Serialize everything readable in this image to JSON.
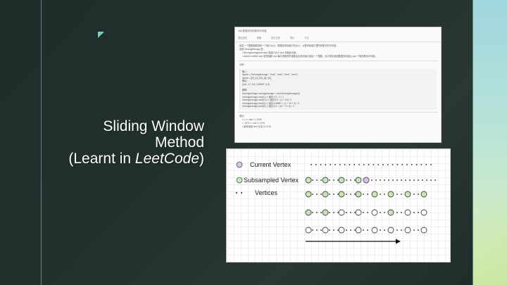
{
  "slide": {
    "title_line1": "Sliding Window",
    "title_line2": "Method",
    "title_line3_prefix": "(Learnt in ",
    "title_line3_italic": "LeetCode",
    "title_line3_suffix": ")",
    "colors": {
      "accent": "#7ecbc0",
      "background": "#22302c",
      "title": "#ffffff"
    }
  },
  "doc": {
    "header": "346.数据流中的移动平均值",
    "tabs": [
      "题目描述",
      "题解",
      "提交记录",
      "笔记",
      "讨论"
    ],
    "lines": [
      "给定一个整数数据流和一个窗口大小，根据该滑动窗口的大小，计算滑动窗口里所有数字的平均值。",
      "实现 MovingAverage 类：",
      "• MovingAverage(int size) 用窗口大小 size 初始化对象。",
      "• double next(int val) 成员函数 next 每次调用的时候都会往滑动窗口增加一个整数，请计算并返回数据流中最后 size 个值的移动平均值。"
    ],
    "example_label": "示例：",
    "input_label": "输入：",
    "code": [
      "inputs = [\"MovingAverage\", \"next\", \"next\", \"next\", \"next\"]",
      "inputs = [[3], [1], [10], [3], [5]]",
      "输出：",
      "[null, 1.0, 5.5, 4.66667, 6.0]"
    ],
    "explain_label": "解释：",
    "explain": [
      "MovingAverage movingAverage = new MovingAverage(3);",
      "movingAverage.next(1); // 返回 1.0 = 1 / 1",
      "movingAverage.next(10); // 返回 5.5 = (1 + 10) / 2",
      "movingAverage.next(3); // 返回 4.66667 = (1 + 10 + 3) / 3",
      "movingAverage.next(5); // 返回 6.0 = (10 + 3 + 5) / 3"
    ],
    "hint_label": "提示：",
    "hints": [
      "• 1 <= size <= 1000",
      "• -10^5 <= val <= 10^5",
      "• 最多调用 next 方法 10^4 次"
    ]
  },
  "diagram": {
    "legend": [
      {
        "label": "Current Vertex",
        "icon": "purple-circle-icon",
        "color": "#d9c2ea"
      },
      {
        "label": "Subsampled Vertex",
        "icon": "green-circle-icon",
        "color": "#c7e6b4"
      },
      {
        "label": "Vertices",
        "icon": "dots-icon",
        "color": "#222222"
      }
    ],
    "colors": {
      "current": "#d9c2ea",
      "subsampled": "#c7e6b4",
      "open": "#ffffff"
    }
  }
}
